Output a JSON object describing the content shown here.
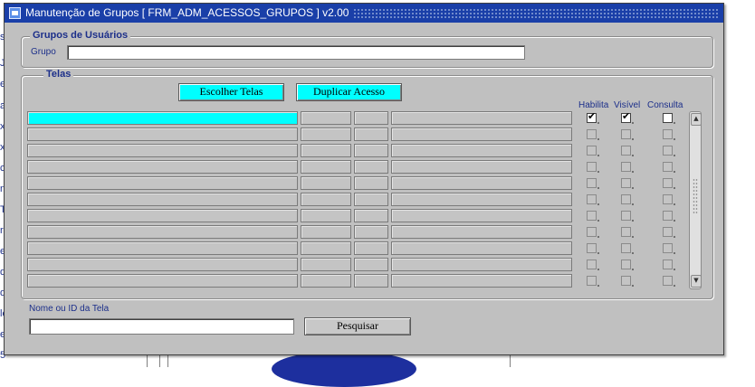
{
  "window": {
    "title": "Manutenção de Grupos [ FRM_ADM_ACESSOS_GRUPOS ] v2.00"
  },
  "background": {
    "left_letters": [
      "s",
      "J:",
      "e",
      "a",
      "x",
      "x",
      "c",
      "n",
      "Tr",
      "r",
      "e",
      "de",
      "de",
      "le",
      "e",
      "5"
    ]
  },
  "grupos_section": {
    "title": "Grupos de Usuários",
    "grupo_label": "Grupo",
    "grupo_value": ""
  },
  "telas_section": {
    "title": "Telas",
    "escolher_button": "Escolher Telas",
    "duplicar_button": "Duplicar Acesso",
    "columns": {
      "habilita": "Habilita",
      "visivel": "Visível",
      "consulta": "Consulta"
    },
    "rows": [
      {
        "c1": "",
        "c2": "",
        "c3": "",
        "c4": "",
        "habilita": true,
        "visivel": true,
        "consulta": false
      },
      {
        "c1": "",
        "c2": "",
        "c3": "",
        "c4": "",
        "habilita": false,
        "visivel": false,
        "consulta": false
      },
      {
        "c1": "",
        "c2": "",
        "c3": "",
        "c4": "",
        "habilita": false,
        "visivel": false,
        "consulta": false
      },
      {
        "c1": "",
        "c2": "",
        "c3": "",
        "c4": "",
        "habilita": false,
        "visivel": false,
        "consulta": false
      },
      {
        "c1": "",
        "c2": "",
        "c3": "",
        "c4": "",
        "habilita": false,
        "visivel": false,
        "consulta": false
      },
      {
        "c1": "",
        "c2": "",
        "c3": "",
        "c4": "",
        "habilita": false,
        "visivel": false,
        "consulta": false
      },
      {
        "c1": "",
        "c2": "",
        "c3": "",
        "c4": "",
        "habilita": false,
        "visivel": false,
        "consulta": false
      },
      {
        "c1": "",
        "c2": "",
        "c3": "",
        "c4": "",
        "habilita": false,
        "visivel": false,
        "consulta": false
      },
      {
        "c1": "",
        "c2": "",
        "c3": "",
        "c4": "",
        "habilita": false,
        "visivel": false,
        "consulta": false
      },
      {
        "c1": "",
        "c2": "",
        "c3": "",
        "c4": "",
        "habilita": false,
        "visivel": false,
        "consulta": false
      },
      {
        "c1": "",
        "c2": "",
        "c3": "",
        "c4": "",
        "habilita": false,
        "visivel": false,
        "consulta": false
      }
    ],
    "active_row": 0
  },
  "search": {
    "label": "Nome ou ID da Tela",
    "value": "",
    "button": "Pesquisar"
  },
  "icons": {
    "title": "oracle-forms-icon",
    "check": "✔",
    "scroll_up": "▲",
    "scroll_down": "▼"
  },
  "colors": {
    "title_bar": "#1a3fa8",
    "highlight": "#00ffff",
    "label_text": "#1c2f8a",
    "window_bg": "#c0c0c0"
  }
}
